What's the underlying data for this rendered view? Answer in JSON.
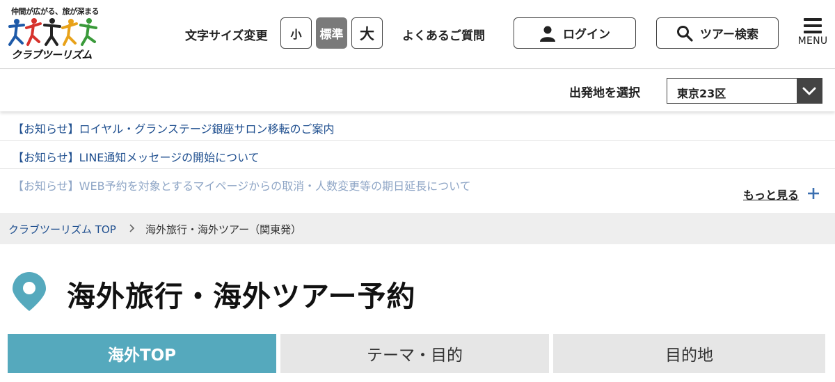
{
  "colors": {
    "accent_teal": "#55a9bd",
    "link_blue": "#1f4f8f",
    "link_faded": "#8fa6c6",
    "breadcrumb_bg": "#eeeeee",
    "tab_bg": "#e6e6e6",
    "selected_size_bg": "#7a7a7a"
  },
  "header": {
    "logo": {
      "tagline": "仲間が広がる、旅が深まる",
      "brand": "クラブツーリズム"
    },
    "font_size": {
      "label": "文字サイズ変更",
      "small": "小",
      "standard": "標準",
      "large": "大",
      "selected": "standard"
    },
    "faq_label": "よくあるご質問",
    "login": {
      "label": "ログイン",
      "icon": "user-icon"
    },
    "tour_search": {
      "label": "ツアー検索",
      "icon": "search-icon"
    },
    "menu": {
      "label": "MENU",
      "icon": "hamburger-icon"
    }
  },
  "departure": {
    "label": "出発地を選択",
    "selected": "東京23区",
    "icon": "chevron-down-icon"
  },
  "news": {
    "items": [
      {
        "text": "【お知らせ】ロイヤル・グランステージ銀座サロン移転のご案内"
      },
      {
        "text": "【お知らせ】LINE通知メッセージの開始について"
      },
      {
        "text": "【お知らせ】WEB予約を対象とするマイページからの取消・人数変更等の期日延長について"
      }
    ],
    "more_label": "もっと見る",
    "more_icon": "plus-icon"
  },
  "breadcrumb": {
    "items": [
      "クラブツーリズム TOP",
      "海外旅行・海外ツアー（関東発）"
    ],
    "separator_icon": "chevron-right-icon"
  },
  "page": {
    "title": "海外旅行・海外ツアー予約",
    "title_icon": "location-pin-icon"
  },
  "tabs": [
    {
      "label": "海外TOP",
      "active": true
    },
    {
      "label": "テーマ・目的",
      "active": false
    },
    {
      "label": "目的地",
      "active": false
    }
  ]
}
